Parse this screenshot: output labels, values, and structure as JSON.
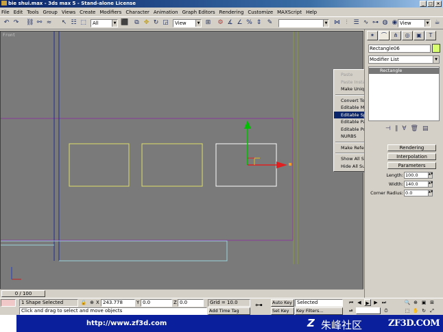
{
  "window": {
    "title": "bie shui.max - 3ds max 5 - Stand-alone License",
    "buttons": [
      "_",
      "□",
      "×"
    ]
  },
  "menu": [
    "File",
    "Edit",
    "Tools",
    "Group",
    "Views",
    "Create",
    "Modifiers",
    "Character",
    "Animation",
    "Graph Editors",
    "Rendering",
    "Customize",
    "MAXScript",
    "Help"
  ],
  "toolbar": {
    "selection_filter": "All",
    "ref_coord": "View",
    "named_selection": "",
    "view_dropdown": "View"
  },
  "viewport": {
    "label": "Front"
  },
  "context_menu": {
    "items": [
      {
        "label": "Paste",
        "disabled": true
      },
      {
        "label": "Paste Instanced",
        "disabled": true
      },
      {
        "label": "Make Unique",
        "disabled": false
      },
      {
        "sep": true
      },
      {
        "label": "Convert To:",
        "disabled": false
      },
      {
        "label": "Editable Mesh",
        "disabled": false
      },
      {
        "label": "Editable Spline",
        "disabled": false,
        "highlighted": true
      },
      {
        "label": "Editable Patch",
        "disabled": false
      },
      {
        "label": "Editable Poly",
        "disabled": false
      },
      {
        "label": "NURBS",
        "disabled": false
      },
      {
        "sep": true
      },
      {
        "label": "Make Reference",
        "disabled": false
      },
      {
        "sep": true
      },
      {
        "label": "Show All Subtrees",
        "disabled": false
      },
      {
        "label": "Hide All Subtrees",
        "disabled": false
      }
    ]
  },
  "command_panel": {
    "object_name": "Rectangle06",
    "object_color": "#d8ff70",
    "modifier_list": "Modifier List",
    "stack_item": "Rectangle",
    "rollouts": [
      "Rendering",
      "Interpolation",
      "Parameters"
    ],
    "params": {
      "length_label": "Length:",
      "length_value": "100.0",
      "width_label": "Width:",
      "width_value": "140.0",
      "corner_label": "Corner Radius:",
      "corner_value": "0.0"
    }
  },
  "time_slider": {
    "frame": "0 / 100"
  },
  "status": {
    "selection": "1 Shape Selected",
    "x_label": "X",
    "x_value": "243.778",
    "y_label": "Y",
    "y_value": "0.0",
    "z_label": "Z",
    "z_value": "0.0",
    "grid": "Grid = 10.0",
    "prompt": "Click and drag to select and move objects",
    "add_time_tag": "Add Time Tag",
    "auto_key": "Auto Key",
    "set_key": "Set Key",
    "key_mode": "Selected",
    "key_filters": "Key Filters..."
  },
  "banner": {
    "url": "http://www.zf3d.com",
    "logo_mark": "Z",
    "cn_text": "朱峰社区",
    "site": "ZF3D.COM"
  }
}
